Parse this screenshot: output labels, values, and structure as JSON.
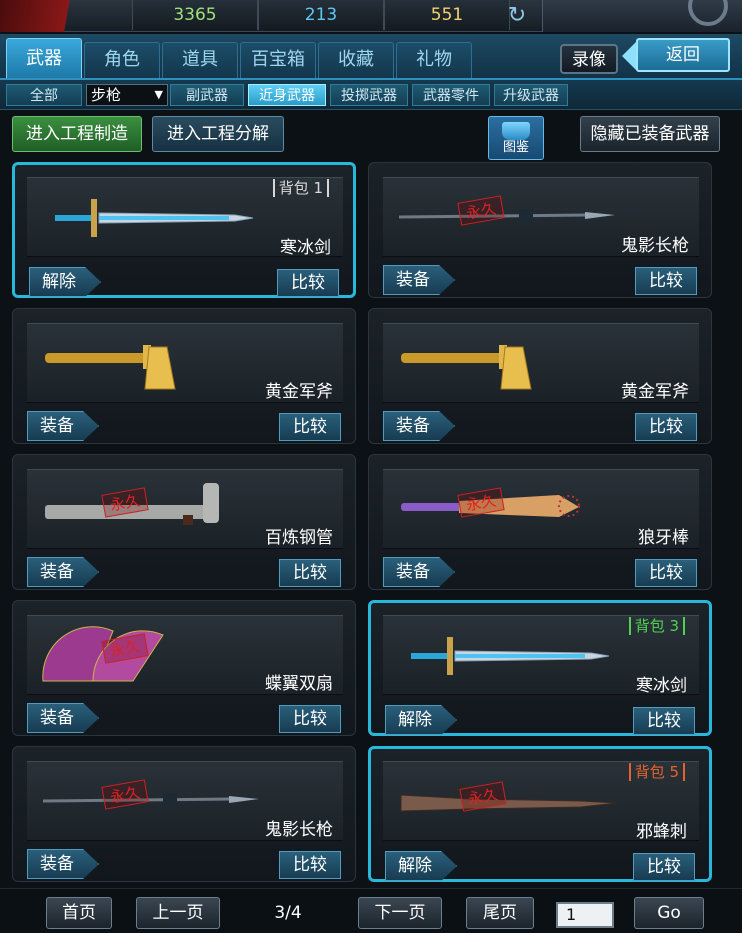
{
  "currency": {
    "gold": "3365",
    "diamond": "213",
    "coupon": "551"
  },
  "tabs": [
    "武器",
    "角色",
    "道具",
    "百宝箱",
    "收藏",
    "礼物"
  ],
  "header_buttons": {
    "record": "录像",
    "back": "返回"
  },
  "subtabs": {
    "all": "全部",
    "selected_weapon_type": "步枪",
    "items": [
      "副武器",
      "近身武器",
      "投掷武器",
      "武器零件",
      "升级武器"
    ]
  },
  "actions": {
    "make": "进入工程制造",
    "decompose": "进入工程分解",
    "atlas": "图鉴",
    "hide_equipped": "隐藏已装备武器"
  },
  "permanent_label": "永久",
  "items": [
    {
      "name": "寒冰剑",
      "badge": "背包 1",
      "badge_color": "#d8d8d8",
      "action": "解除",
      "compare": "比较",
      "equipped": true,
      "permanent": false,
      "icon": "ice-sword-icon"
    },
    {
      "name": "鬼影长枪",
      "badge": "",
      "badge_color": "",
      "action": "装备",
      "compare": "比较",
      "equipped": false,
      "permanent": true,
      "icon": "spear-icon"
    },
    {
      "name": "黄金军斧",
      "badge": "",
      "badge_color": "",
      "action": "装备",
      "compare": "比较",
      "equipped": false,
      "permanent": false,
      "icon": "golden-axe-icon"
    },
    {
      "name": "黄金军斧",
      "badge": "",
      "badge_color": "",
      "action": "装备",
      "compare": "比较",
      "equipped": false,
      "permanent": false,
      "icon": "golden-axe-icon"
    },
    {
      "name": "百炼钢管",
      "badge": "",
      "badge_color": "",
      "action": "装备",
      "compare": "比较",
      "equipped": false,
      "permanent": true,
      "icon": "steel-pipe-icon"
    },
    {
      "name": "狼牙棒",
      "badge": "",
      "badge_color": "",
      "action": "装备",
      "compare": "比较",
      "equipped": false,
      "permanent": true,
      "icon": "spiked-bat-icon"
    },
    {
      "name": "蝶翼双扇",
      "badge": "",
      "badge_color": "",
      "action": "装备",
      "compare": "比较",
      "equipped": false,
      "permanent": true,
      "icon": "twin-fans-icon"
    },
    {
      "name": "寒冰剑",
      "badge": "背包 3",
      "badge_color": "#4fd24f",
      "action": "解除",
      "compare": "比较",
      "equipped": true,
      "permanent": false,
      "icon": "ice-sword-icon"
    },
    {
      "name": "鬼影长枪",
      "badge": "",
      "badge_color": "",
      "action": "装备",
      "compare": "比较",
      "equipped": false,
      "permanent": true,
      "icon": "spear-icon"
    },
    {
      "name": "邪蜂刺",
      "badge": "背包 5",
      "badge_color": "#e5632b",
      "action": "解除",
      "compare": "比较",
      "equipped": true,
      "permanent": true,
      "icon": "wasp-sting-icon"
    }
  ],
  "pager": {
    "first": "首页",
    "prev": "上一页",
    "info": "3/4",
    "next": "下一页",
    "last": "尾页",
    "page_input": "1",
    "go": "Go"
  }
}
